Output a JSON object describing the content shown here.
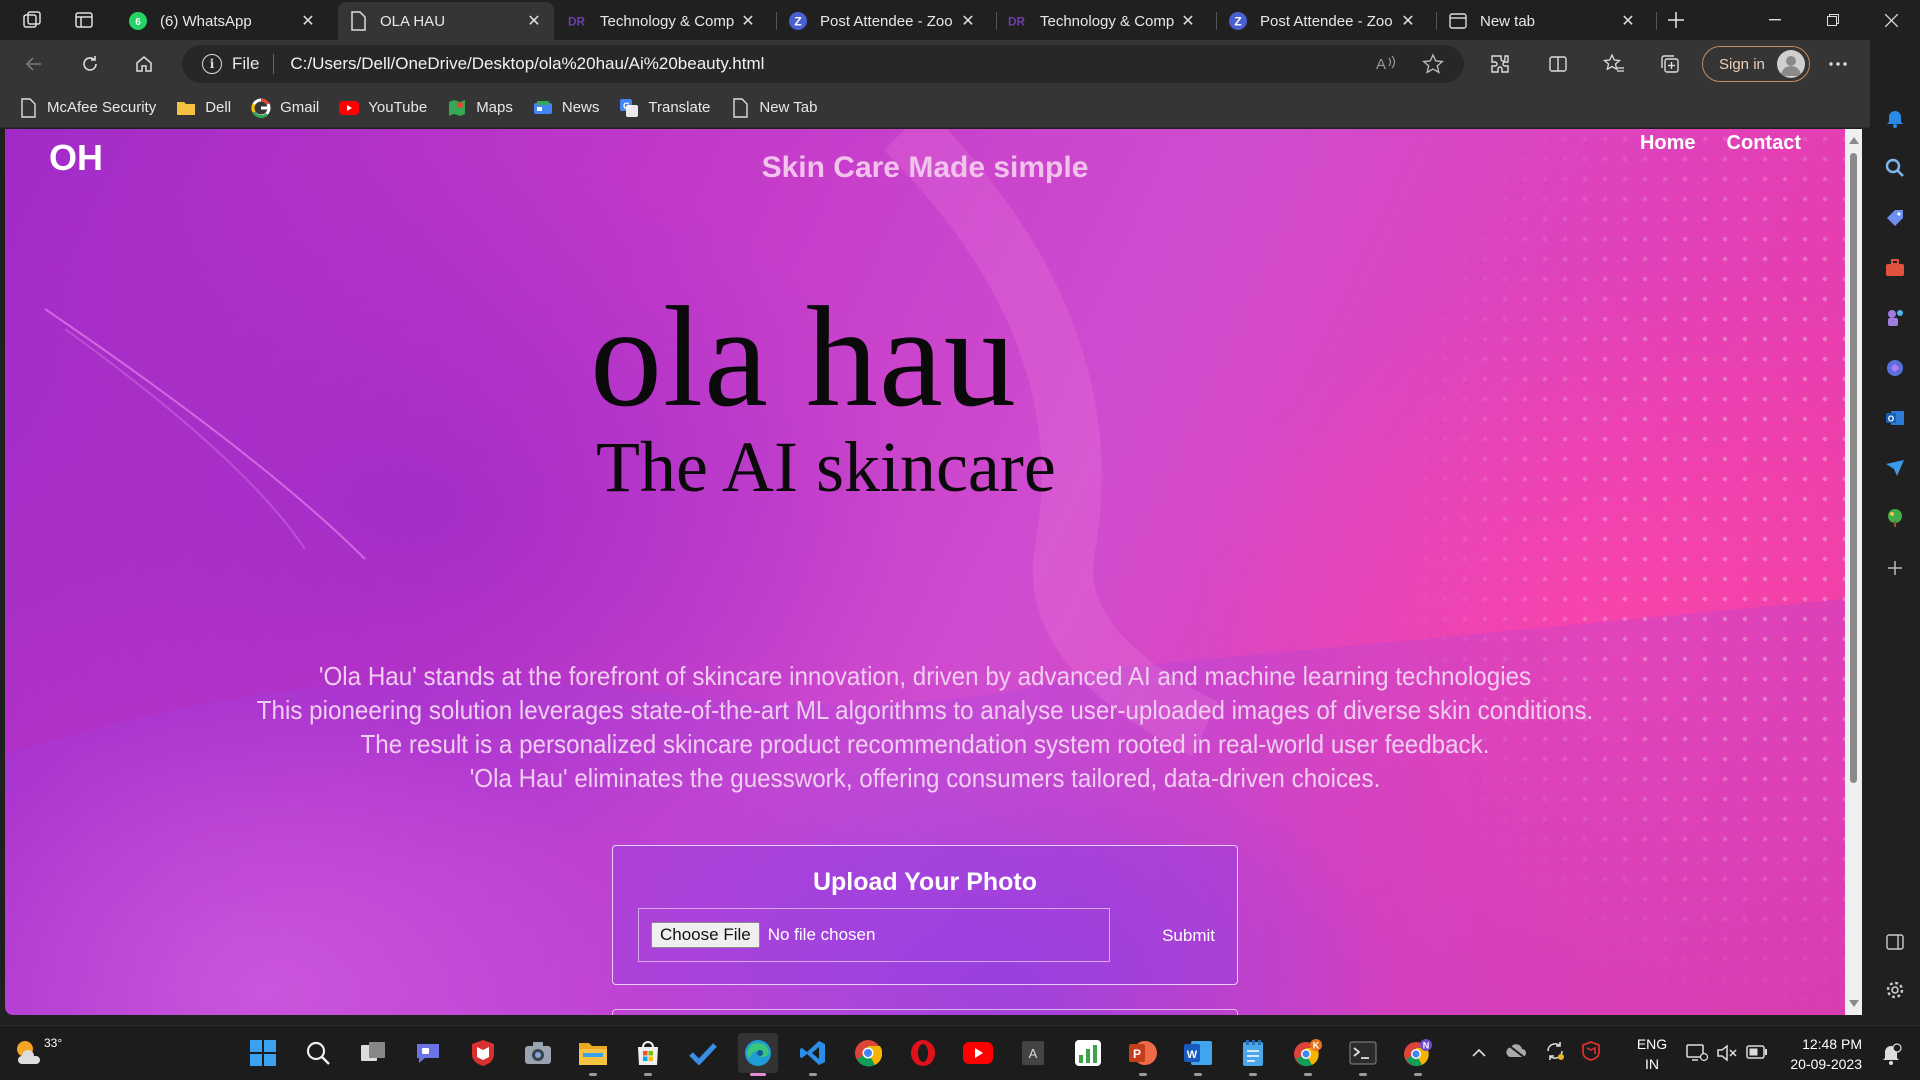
{
  "browser": {
    "tabs": [
      {
        "title": "(6) WhatsApp",
        "icon": "whatsapp-icon",
        "active": false
      },
      {
        "title": "OLA HAU",
        "icon": "page-icon",
        "active": true
      },
      {
        "title": "Technology & Comp",
        "icon": "dr-icon",
        "active": false
      },
      {
        "title": "Post Attendee - Zoo",
        "icon": "zoom-icon",
        "active": false
      },
      {
        "title": "Technology & Comp",
        "icon": "dr-icon",
        "active": false
      },
      {
        "title": "Post Attendee - Zoo",
        "icon": "zoom-icon",
        "active": false
      },
      {
        "title": "New tab",
        "icon": "newtab-icon",
        "active": false
      }
    ],
    "address": {
      "scheme_label": "File",
      "url": "C:/Users/Dell/OneDrive/Desktop/ola%20hau/Ai%20beauty.html"
    },
    "signin_label": "Sign in",
    "bookmarks": [
      {
        "label": "McAfee Security",
        "icon": "page-icon"
      },
      {
        "label": "Dell",
        "icon": "folder-icon"
      },
      {
        "label": "Gmail",
        "icon": "google-icon"
      },
      {
        "label": "YouTube",
        "icon": "youtube-icon"
      },
      {
        "label": "Maps",
        "icon": "maps-icon"
      },
      {
        "label": "News",
        "icon": "news-icon"
      },
      {
        "label": "Translate",
        "icon": "translate-icon"
      },
      {
        "label": "New Tab",
        "icon": "page-icon"
      }
    ]
  },
  "page": {
    "logo": "OH",
    "tagline": "Skin Care Made simple",
    "nav": {
      "home": "Home",
      "contact": "Contact"
    },
    "brand": {
      "name": "ola hau",
      "subtitle": "The AI skincare"
    },
    "description": [
      "'Ola Hau' stands at the forefront of skincare innovation, driven by advanced AI and machine learning technologies",
      "This pioneering solution leverages state-of-the-art ML algorithms to analyse user-uploaded images of diverse skin conditions.",
      "The result is a personalized skincare product recommendation system rooted in real-world user feedback.",
      "'Ola Hau' eliminates the guesswork, offering consumers tailored, data-driven choices."
    ],
    "upload": {
      "title": "Upload Your Photo",
      "choose_label": "Choose File",
      "status": "No file chosen",
      "submit_label": "Submit"
    },
    "colors": {
      "gradient_start": "#a02bc8",
      "gradient_end": "#ee3b9f",
      "tagline": "#f2c2ec"
    }
  },
  "taskbar": {
    "weather_temp": "33°",
    "language": {
      "line1": "ENG",
      "line2": "IN"
    },
    "time": "12:48 PM",
    "date": "20-09-2023",
    "badges": {
      "chrome_k": "K",
      "chrome_n": "N"
    }
  }
}
